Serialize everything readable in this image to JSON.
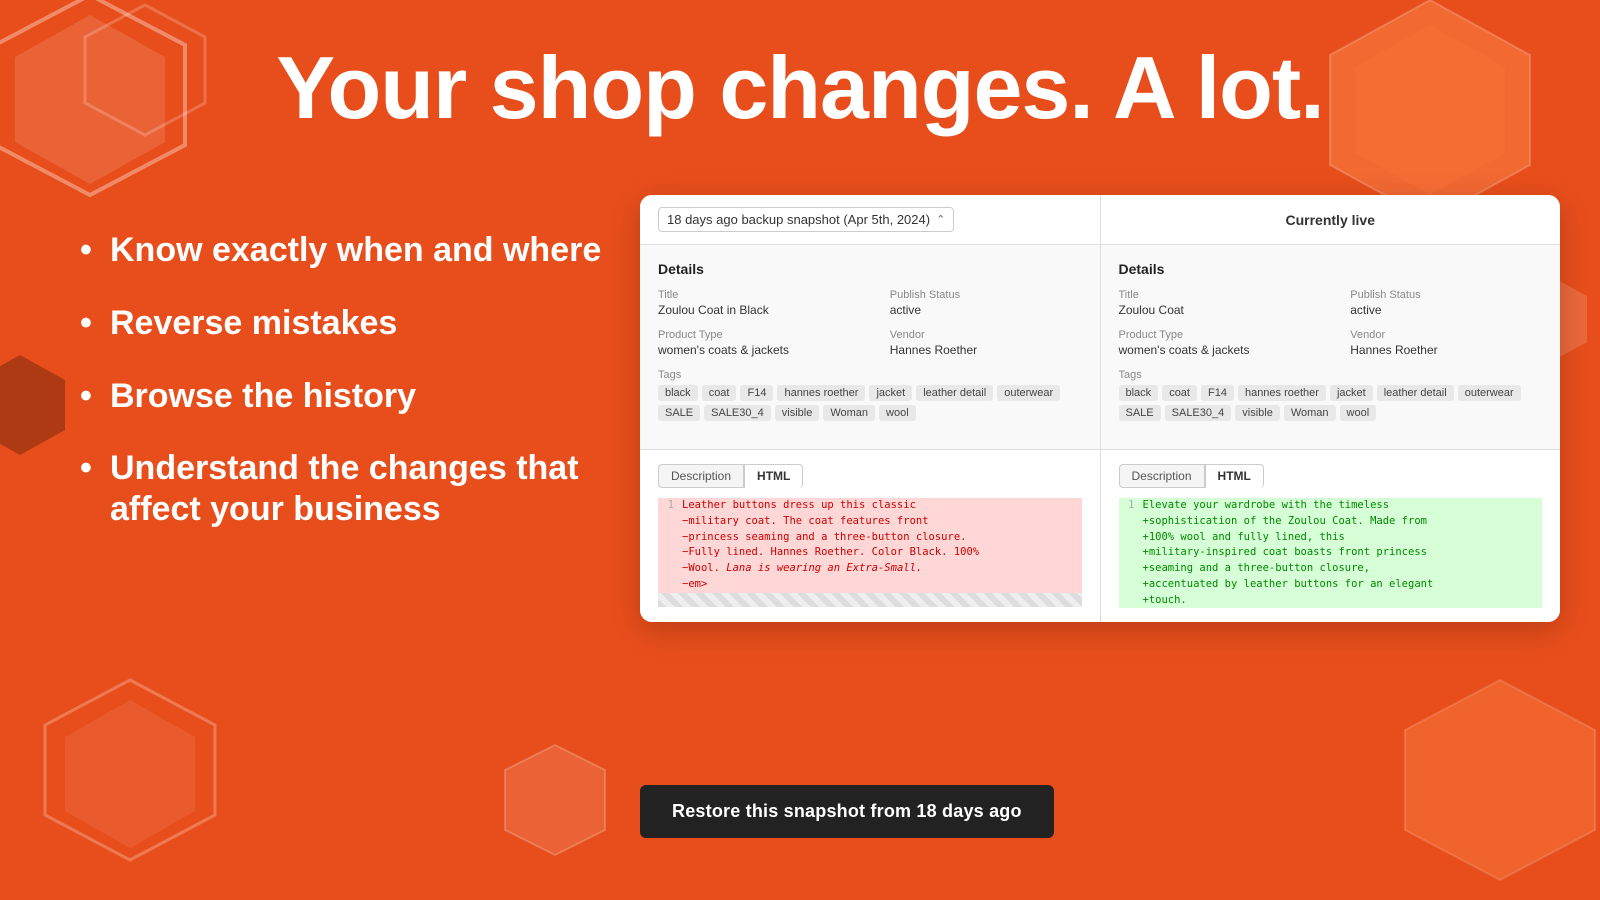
{
  "page": {
    "headline": "Your shop changes. A lot.",
    "bullets": [
      "Know exactly when and where",
      "Reverse mistakes",
      "Browse the history",
      "Understand the changes that affect your business"
    ]
  },
  "comparison": {
    "left_header": "18 days ago backup snapshot (Apr 5th, 2024)",
    "right_header": "Currently live",
    "left": {
      "section_title": "Details",
      "title_label": "Title",
      "title_value": "Zoulou Coat in Black",
      "publish_label": "Publish Status",
      "publish_value": "active",
      "product_type_label": "Product Type",
      "product_type_value": "women's coats & jackets",
      "vendor_label": "Vendor",
      "vendor_value": "Hannes Roether",
      "tags_label": "Tags",
      "tags": [
        "black",
        "coat",
        "F14",
        "hannes roether",
        "jacket",
        "leather detail",
        "outerwear",
        "SALE",
        "SALE30_4",
        "visible",
        "Woman",
        "wool"
      ],
      "desc_tab1": "Description",
      "desc_tab2": "HTML",
      "code_lines": [
        {
          "num": "1",
          "text": "<p>Leather buttons dress up this classic",
          "type": "old"
        },
        {
          "num": "",
          "text": "−military coat. The coat features front",
          "type": "old"
        },
        {
          "num": "",
          "text": "−princess seaming and a three-button closure.",
          "type": "old"
        },
        {
          "num": "",
          "text": "−Fully lined. Hannes Roether. Color Black. 100%",
          "type": "old"
        },
        {
          "num": "",
          "text": "−Wool. <em>Lana is wearing an Extra-Small.</",
          "type": "old"
        },
        {
          "num": "",
          "text": "−em></p>",
          "type": "old"
        }
      ]
    },
    "right": {
      "section_title": "Details",
      "title_label": "Title",
      "title_value": "Zoulou Coat",
      "publish_label": "Publish Status",
      "publish_value": "active",
      "product_type_label": "Product Type",
      "product_type_value": "women's coats & jackets",
      "vendor_label": "Vendor",
      "vendor_value": "Hannes Roether",
      "tags_label": "Tags",
      "tags": [
        "black",
        "coat",
        "F14",
        "hannes roether",
        "jacket",
        "leather detail",
        "outerwear",
        "SALE",
        "SALE30_4",
        "visible",
        "Woman",
        "wool"
      ],
      "desc_tab1": "Description",
      "desc_tab2": "HTML",
      "code_lines": [
        {
          "num": "1",
          "text": "<p>Elevate your wardrobe with the timeless",
          "type": "new"
        },
        {
          "num": "",
          "text": "+sophistication of the Zoulou Coat. Made from",
          "type": "new"
        },
        {
          "num": "",
          "text": "+100% wool and fully lined, this",
          "type": "new"
        },
        {
          "num": "",
          "text": "+military-inspired coat boasts front princess",
          "type": "new"
        },
        {
          "num": "",
          "text": "+seaming and a three-button closure,",
          "type": "new"
        },
        {
          "num": "",
          "text": "+accentuated by leather buttons for an elegant",
          "type": "new"
        },
        {
          "num": "",
          "text": "+touch. <em></em></p>",
          "type": "new"
        }
      ]
    }
  },
  "restore_button": "Restore this snapshot from 18 days ago"
}
